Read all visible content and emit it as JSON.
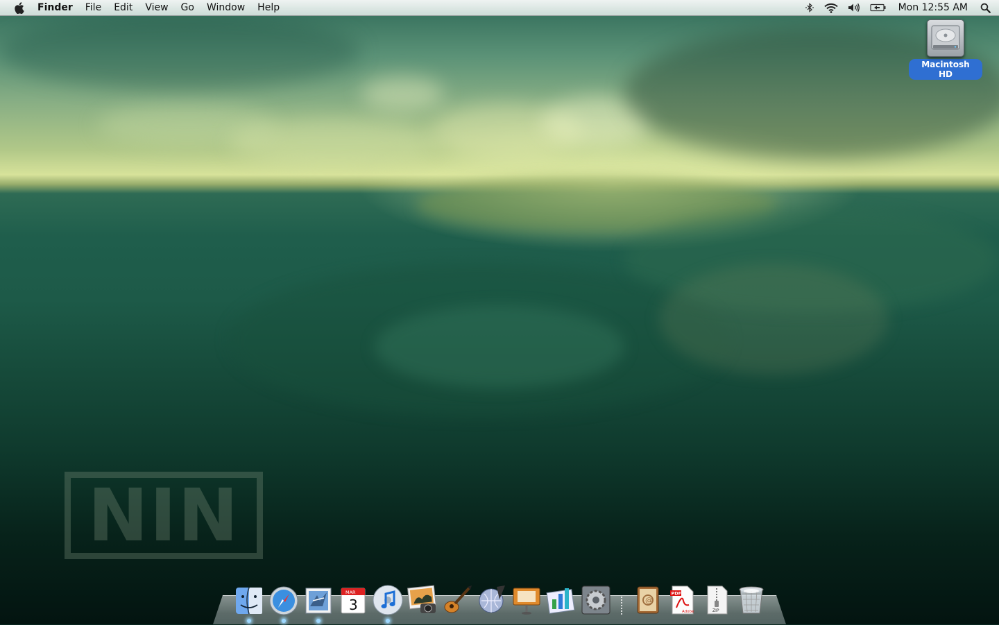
{
  "menubar": {
    "apple_icon": "apple-icon",
    "app_name": "Finder",
    "menus": [
      "File",
      "Edit",
      "View",
      "Go",
      "Window",
      "Help"
    ],
    "status_icons": [
      "bluetooth-icon",
      "wifi-icon",
      "volume-icon",
      "battery-icon"
    ],
    "clock": "Mon 12:55 AM",
    "spotlight_icon": "spotlight-icon"
  },
  "desktop": {
    "icons": [
      {
        "label": "Macintosh HD",
        "icon": "hard-drive-icon"
      }
    ],
    "wallpaper_logo": "NIN"
  },
  "dock": {
    "apps": [
      {
        "name": "Finder",
        "icon": "finder-icon",
        "running": true
      },
      {
        "name": "Safari",
        "icon": "safari-icon",
        "running": true
      },
      {
        "name": "Mail",
        "icon": "mail-icon",
        "running": true
      },
      {
        "name": "iCal",
        "icon": "ical-icon",
        "running": false,
        "month": "MAR",
        "day": "3"
      },
      {
        "name": "iTunes",
        "icon": "itunes-icon",
        "running": true
      },
      {
        "name": "iPhoto",
        "icon": "iphoto-icon",
        "running": false
      },
      {
        "name": "GarageBand",
        "icon": "garageband-icon",
        "running": false
      },
      {
        "name": "iWeb",
        "icon": "iweb-icon",
        "running": false
      },
      {
        "name": "Keynote",
        "icon": "keynote-icon",
        "running": false
      },
      {
        "name": "Numbers",
        "icon": "numbers-icon",
        "running": false
      },
      {
        "name": "System Preferences",
        "icon": "system-preferences-icon",
        "running": false
      }
    ],
    "stacks": [
      {
        "name": "Address Book",
        "icon": "address-book-icon"
      },
      {
        "name": "PDF Document",
        "icon": "pdf-document-icon",
        "badge": "PDF",
        "brand": "Adobe"
      },
      {
        "name": "ZIP Archive",
        "icon": "zip-archive-icon",
        "badge": "ZIP"
      },
      {
        "name": "Trash",
        "icon": "trash-icon"
      }
    ]
  }
}
